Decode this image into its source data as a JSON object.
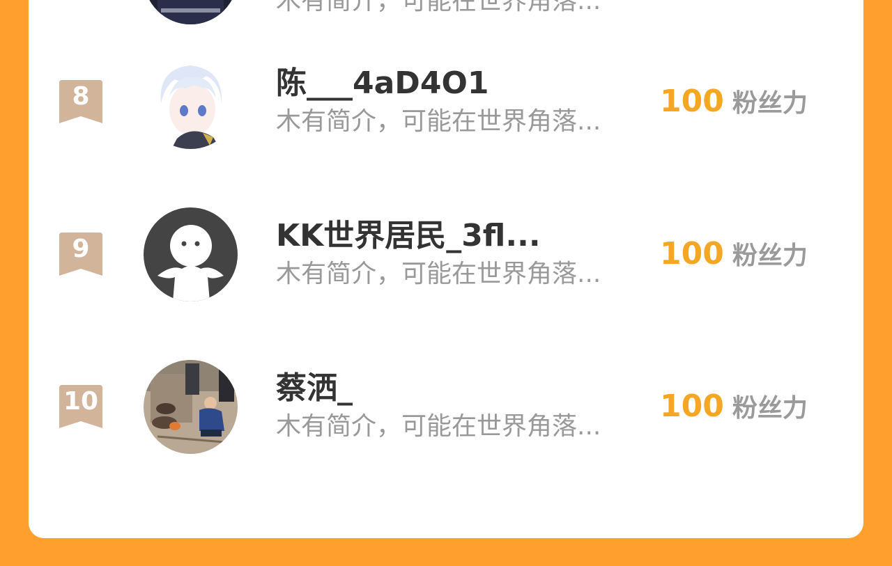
{
  "colors": {
    "background": "#FF9F2E",
    "card": "#FFFFFF",
    "badge": "#D2B49A",
    "score": "#F5A623",
    "name": "#333333",
    "bio": "#999999"
  },
  "top_partial_row": {
    "bio": "木有简介，可能在世界角落..."
  },
  "rows": [
    {
      "rank": "8",
      "name": "陈___4aD4O1",
      "bio": "木有简介，可能在世界角落...",
      "score": "100",
      "score_unit": "粉丝力",
      "avatar_icon": "anime-character-avatar"
    },
    {
      "rank": "9",
      "name": "KK世界居民_3fl...",
      "bio": "木有简介，可能在世界角落...",
      "score": "100",
      "score_unit": "粉丝力",
      "avatar_icon": "default-user-avatar"
    },
    {
      "rank": "10",
      "name": "蔡洒_",
      "bio": "木有简介，可能在世界角落...",
      "score": "100",
      "score_unit": "粉丝力",
      "avatar_icon": "photo-avatar"
    }
  ]
}
